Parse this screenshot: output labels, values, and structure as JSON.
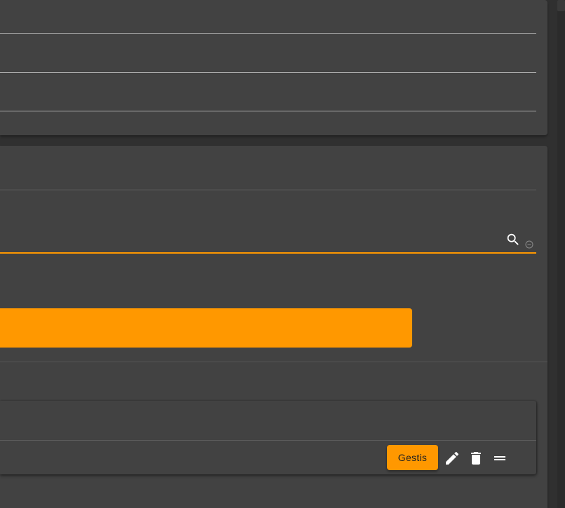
{
  "colors": {
    "accent": "#ff9800",
    "surface": "#424242",
    "background": "#303030"
  },
  "top_card": {
    "rows": [
      "",
      "",
      ""
    ]
  },
  "search": {
    "value": "",
    "search_icon": "search-icon",
    "clear_icon": "minus-circle-icon"
  },
  "primary_action": {
    "label": ""
  },
  "list": {
    "items": [
      {
        "label": "",
        "actions": {
          "gestis_label": "Gestis",
          "edit_icon": "pencil-icon",
          "delete_icon": "trash-icon",
          "drag_icon": "drag-handle-icon"
        }
      }
    ]
  }
}
